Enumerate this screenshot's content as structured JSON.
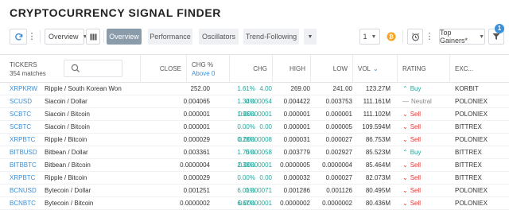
{
  "title": "CRYPTOCURRENCY SIGNAL FINDER",
  "toolbar": {
    "columns_select": "Overview",
    "tabs": [
      "Overview",
      "Performance",
      "Oscillators",
      "Trend-Following"
    ],
    "interval": "1",
    "sort_select": "Top Gainers*",
    "filter_count": "1"
  },
  "header": {
    "tickers_label": "TICKERS",
    "matches": "354 matches",
    "close": "CLOSE",
    "chg_pct": "CHG %",
    "chg_pct_sub": "Above 0",
    "chg": "CHG",
    "high": "HIGH",
    "low": "LOW",
    "vol": "VOL",
    "rating": "RATING",
    "exchange": "EXC..."
  },
  "rows": [
    {
      "ticker": "XRPKRW",
      "desc": "Ripple / South Korean Won",
      "close": "252.00",
      "chg_pct": "1.61%",
      "chg": "4.00",
      "high": "269.00",
      "low": "241.00",
      "vol": "123.27M",
      "rating": "Buy",
      "rating_type": "buy",
      "exchange": "KORBIT"
    },
    {
      "ticker": "SCUSD",
      "desc": "Siacoin / Dollar",
      "close": "0.004065",
      "chg_pct": "1.34%",
      "chg": "0.000054",
      "high": "0.004422",
      "low": "0.003753",
      "vol": "111.161M",
      "rating": "Neutral",
      "rating_type": "neutral",
      "exchange": "POLONIEX"
    },
    {
      "ticker": "SCBTC",
      "desc": "Siacoin / Bitcoin",
      "close": "0.000001",
      "chg_pct": "1.96%",
      "chg": "0.00000001",
      "high": "0.000001",
      "low": "0.000001",
      "vol": "111.102M",
      "rating": "Sell",
      "rating_type": "sell",
      "exchange": "POLONIEX"
    },
    {
      "ticker": "SCBTC",
      "desc": "Siacoin / Bitcoin",
      "close": "0.000001",
      "chg_pct": "0.00%",
      "chg": "0.00",
      "high": "0.000001",
      "low": "0.000005",
      "vol": "109.594M",
      "rating": "Sell",
      "rating_type": "sell",
      "exchange": "BITTREX"
    },
    {
      "ticker": "XRPBTC",
      "desc": "Ripple / Bitcoin",
      "close": "0.000029",
      "chg_pct": "0.28%",
      "chg": "0.00000008",
      "high": "0.000031",
      "low": "0.000027",
      "vol": "86.753M",
      "rating": "Sell",
      "rating_type": "sell",
      "exchange": "POLONIEX"
    },
    {
      "ticker": "BITBUSD",
      "desc": "Bitbean / Dollar",
      "close": "0.003361",
      "chg_pct": "1.75%",
      "chg": "0.000058",
      "high": "0.003779",
      "low": "0.002927",
      "vol": "85.523M",
      "rating": "Buy",
      "rating_type": "buy",
      "exchange": "BITTREX"
    },
    {
      "ticker": "BITBBTC",
      "desc": "Bitbean / Bitcoin",
      "close": "0.0000004",
      "chg_pct": "2.38%",
      "chg": "0.00000001",
      "high": "0.0000005",
      "low": "0.0000004",
      "vol": "85.464M",
      "rating": "Sell",
      "rating_type": "sell",
      "exchange": "BITTREX"
    },
    {
      "ticker": "XRPBTC",
      "desc": "Ripple / Bitcoin",
      "close": "0.000029",
      "chg_pct": "0.00%",
      "chg": "0.00",
      "high": "0.000032",
      "low": "0.000027",
      "vol": "82.073M",
      "rating": "Sell",
      "rating_type": "sell",
      "exchange": "BITTREX"
    },
    {
      "ticker": "BCNUSD",
      "desc": "Bytecoin / Dollar",
      "close": "0.001251",
      "chg_pct": "6.01%",
      "chg": "0.000071",
      "high": "0.001286",
      "low": "0.001126",
      "vol": "80.495M",
      "rating": "Sell",
      "rating_type": "sell",
      "exchange": "POLONIEX"
    },
    {
      "ticker": "BCNBTC",
      "desc": "Bytecoin / Bitcoin",
      "close": "0.0000002",
      "chg_pct": "6.67%",
      "chg": "0.00000001",
      "high": "0.0000002",
      "low": "0.0000002",
      "vol": "80.436M",
      "rating": "Sell",
      "rating_type": "sell",
      "exchange": "POLONIEX"
    }
  ]
}
